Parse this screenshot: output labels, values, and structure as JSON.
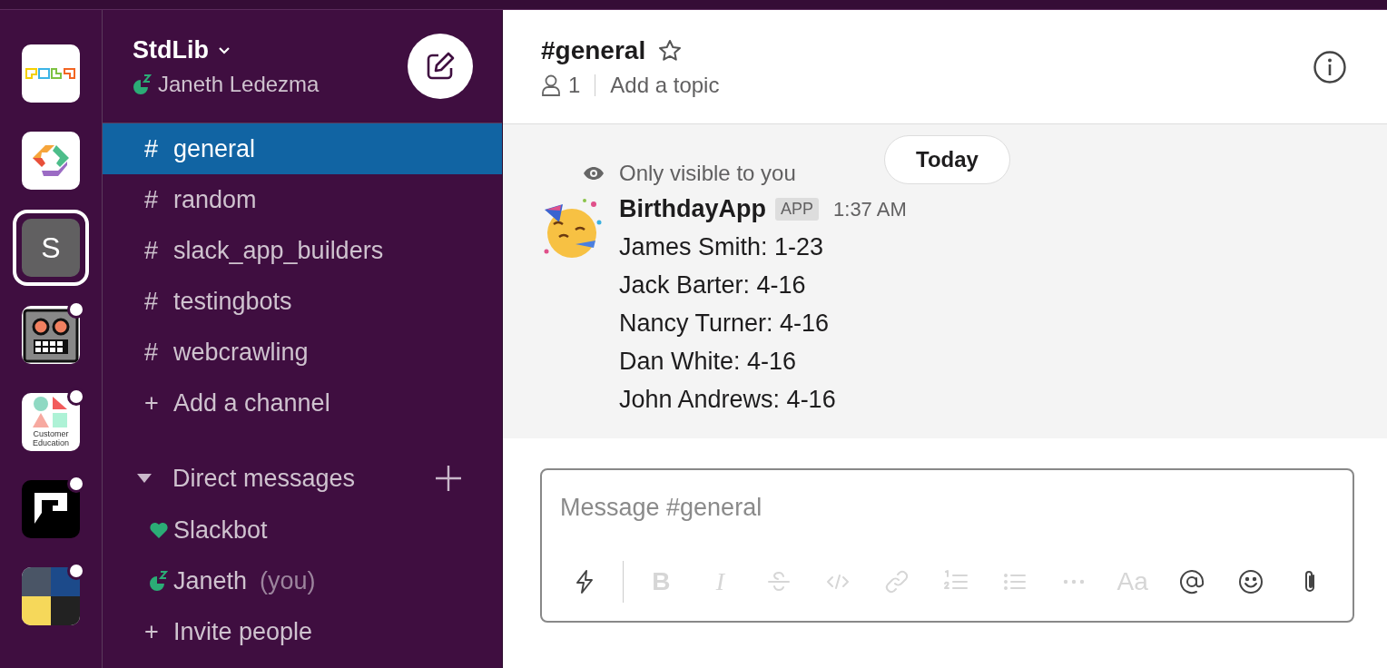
{
  "workspaces": [
    {
      "kind": "blocks",
      "selected": false,
      "unread": false
    },
    {
      "kind": "ring",
      "selected": false,
      "unread": false
    },
    {
      "kind": "letter",
      "label": "S",
      "selected": true,
      "unread": false
    },
    {
      "kind": "robot",
      "selected": false,
      "unread": true
    },
    {
      "kind": "shapes",
      "label": "Customer Education",
      "selected": false,
      "unread": true
    },
    {
      "kind": "chat",
      "selected": false,
      "unread": true
    },
    {
      "kind": "collage",
      "selected": false,
      "unread": true
    }
  ],
  "team": {
    "name": "StdLib",
    "user": "Janeth Ledezma"
  },
  "channels": [
    {
      "prefix": "#",
      "name": "general",
      "selected": true
    },
    {
      "prefix": "#",
      "name": "random",
      "selected": false
    },
    {
      "prefix": "#",
      "name": "slack_app_builders",
      "selected": false
    },
    {
      "prefix": "#",
      "name": "testingbots",
      "selected": false
    },
    {
      "prefix": "#",
      "name": "webcrawling",
      "selected": false
    }
  ],
  "add_channel": {
    "prefix": "+",
    "label": "Add a channel"
  },
  "direct_messages": {
    "title": "Direct messages",
    "expanded": true,
    "items": [
      {
        "kind": "bot",
        "name": "Slackbot"
      },
      {
        "kind": "away",
        "name": "Janeth",
        "suffix": "(you)"
      }
    ]
  },
  "invite": {
    "prefix": "+",
    "label": "Invite people"
  },
  "header": {
    "channel": "#general",
    "starred": false,
    "members": "1",
    "topic": "Add a topic"
  },
  "date_divider": "Today",
  "ephemeral_note": "Only visible to you",
  "message": {
    "author": "BirthdayApp",
    "badge": "APP",
    "time": "1:37 AM",
    "lines": [
      "James Smith: 1-23",
      "Jack Barter: 4-16",
      "Nancy Turner: 4-16",
      "Dan White: 4-16",
      "John Andrews: 4-16"
    ]
  },
  "composer": {
    "placeholder": "Message #general",
    "toolbar": [
      {
        "disabled": false
      },
      {
        "label": "B",
        "disabled": true
      },
      {
        "label": "I",
        "disabled": true
      },
      {
        "disabled": true
      },
      {
        "disabled": true
      },
      {
        "disabled": true
      },
      {
        "disabled": true
      },
      {
        "disabled": true
      },
      {
        "disabled": true
      },
      {
        "label": "Aa",
        "disabled": true
      },
      {
        "disabled": false
      },
      {
        "disabled": false
      },
      {
        "disabled": false
      }
    ]
  }
}
